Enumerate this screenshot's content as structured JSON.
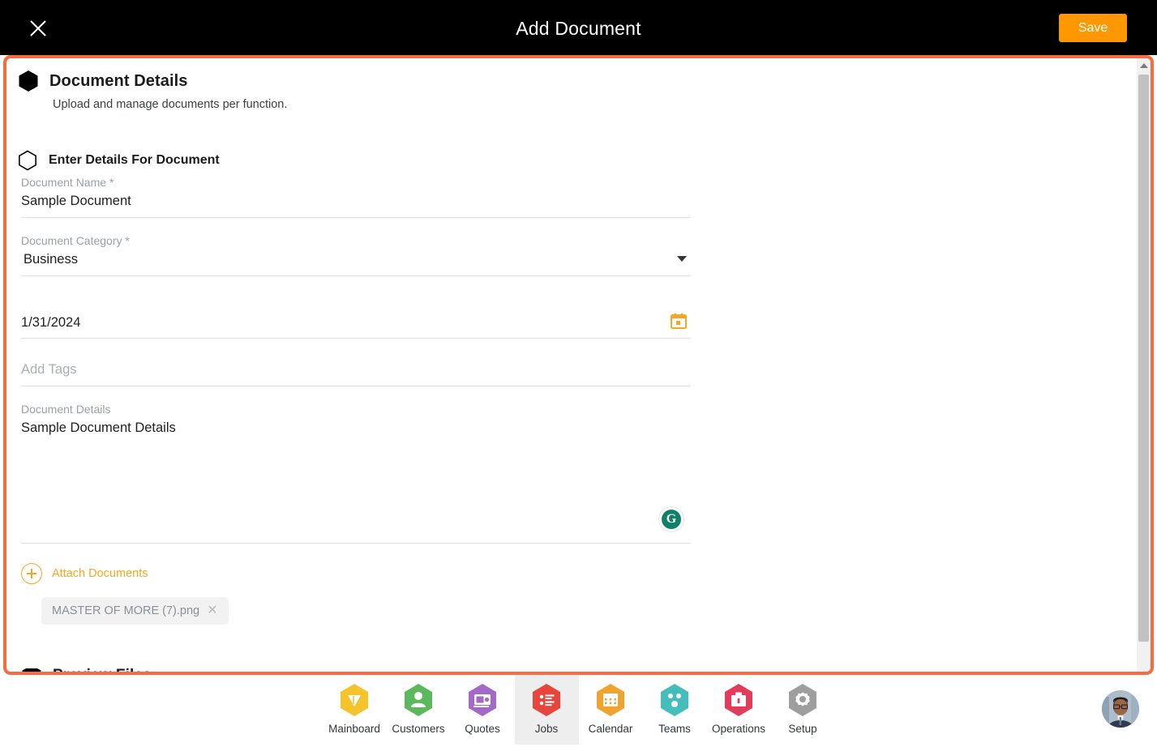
{
  "header": {
    "title": "Add Document",
    "close_icon": "close-icon",
    "save_label": "Save",
    "save_color": "#FF9800"
  },
  "panel": {
    "border_color": "#F96C3D",
    "section": {
      "title": "Document Details",
      "subtitle": "Upload and manage documents per function.",
      "icon": "hexagon-filled-icon"
    },
    "subsection": {
      "title": "Enter Details For Document",
      "icon": "hexagon-outline-icon"
    },
    "fields": {
      "document_name": {
        "label": "Document Name",
        "required": "*",
        "value": "Sample Document"
      },
      "document_category": {
        "label": "Document Category",
        "required": "*",
        "value": "Business",
        "caret_icon": "chevron-down-icon"
      },
      "date": {
        "value": "1/31/2024",
        "icon": "calendar-icon",
        "icon_color": "#F5A623"
      },
      "tags": {
        "placeholder": "Add Tags",
        "value": ""
      },
      "document_details": {
        "label": "Document Details",
        "value": "Sample Document Details",
        "assistant_icon": "grammarly-icon",
        "assistant_letter": "G",
        "assistant_color": "#11806a"
      }
    },
    "attach": {
      "label": "Attach Documents",
      "icon": "plus-circle-icon",
      "color": "#F5A623",
      "files": [
        {
          "name": "MASTER OF MORE (7).png",
          "remove_icon": "close-icon"
        }
      ]
    },
    "next_section": {
      "title": "Preview Files",
      "icon": "hexagon-filled-icon"
    },
    "scrollbar": {
      "up_arrow_icon": "triangle-up-icon"
    }
  },
  "bottomnav": {
    "items": [
      {
        "label": "Mainboard",
        "icon": "mainboard-icon",
        "color": "#F5C32C",
        "active": false
      },
      {
        "label": "Customers",
        "icon": "person-icon",
        "color": "#5CB85C",
        "active": false
      },
      {
        "label": "Quotes",
        "icon": "money-icon",
        "color": "#A369C9",
        "active": false
      },
      {
        "label": "Jobs",
        "icon": "list-icon",
        "color": "#E8453C",
        "active": true
      },
      {
        "label": "Calendar",
        "icon": "calendar-icon",
        "color": "#F0A32E",
        "active": false
      },
      {
        "label": "Teams",
        "icon": "teams-icon",
        "color": "#45BDBD",
        "active": false
      },
      {
        "label": "Operations",
        "icon": "briefcase-icon",
        "color": "#E23C5B",
        "active": false
      },
      {
        "label": "Setup",
        "icon": "gear-icon",
        "color": "#9E9E9E",
        "active": false
      }
    ],
    "avatar": "user-avatar"
  }
}
